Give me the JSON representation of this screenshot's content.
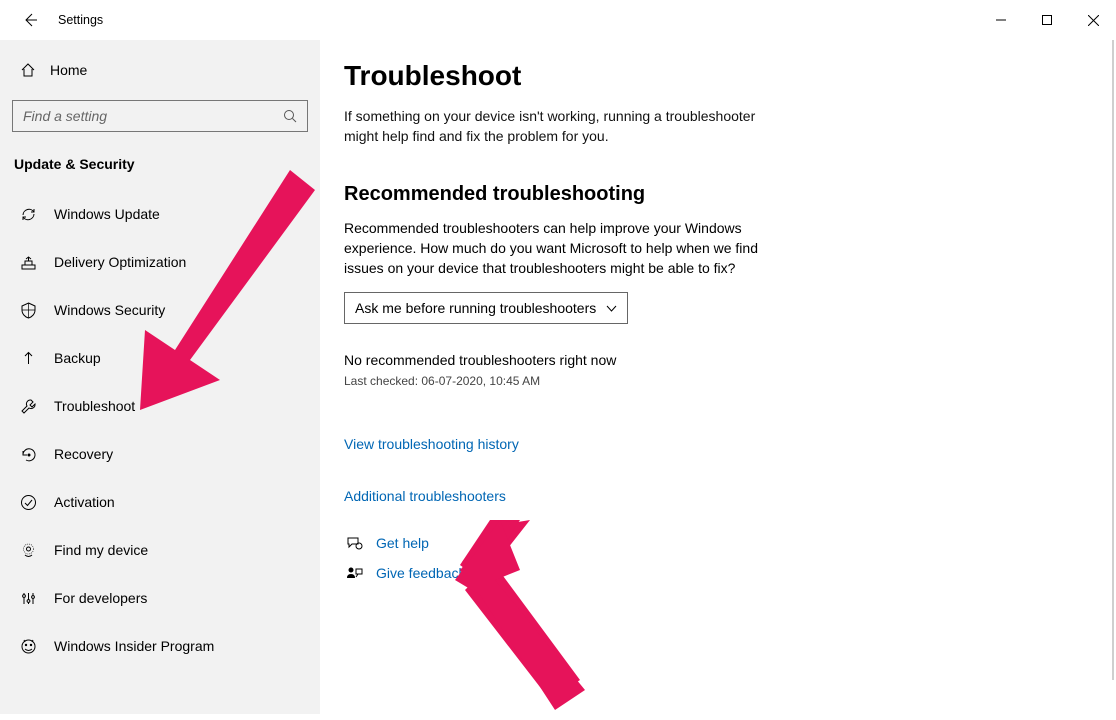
{
  "window": {
    "title": "Settings"
  },
  "sidebar": {
    "home": "Home",
    "search_placeholder": "Find a setting",
    "category": "Update & Security",
    "items": [
      {
        "label": "Windows Update"
      },
      {
        "label": "Delivery Optimization"
      },
      {
        "label": "Windows Security"
      },
      {
        "label": "Backup"
      },
      {
        "label": "Troubleshoot"
      },
      {
        "label": "Recovery"
      },
      {
        "label": "Activation"
      },
      {
        "label": "Find my device"
      },
      {
        "label": "For developers"
      },
      {
        "label": "Windows Insider Program"
      }
    ]
  },
  "main": {
    "title": "Troubleshoot",
    "intro": "If something on your device isn't working, running a troubleshooter might help find and fix the problem for you.",
    "section_title": "Recommended troubleshooting",
    "section_desc": "Recommended troubleshooters can help improve your Windows experience. How much do you want Microsoft to help when we find issues on your device that troubleshooters might be able to fix?",
    "dropdown_value": "Ask me before running troubleshooters",
    "no_rec": "No recommended troubleshooters right now",
    "last_checked": "Last checked: 06-07-2020, 10:45 AM",
    "history_link": "View troubleshooting history",
    "additional_link": "Additional troubleshooters",
    "get_help": "Get help",
    "give_feedback": "Give feedback"
  }
}
